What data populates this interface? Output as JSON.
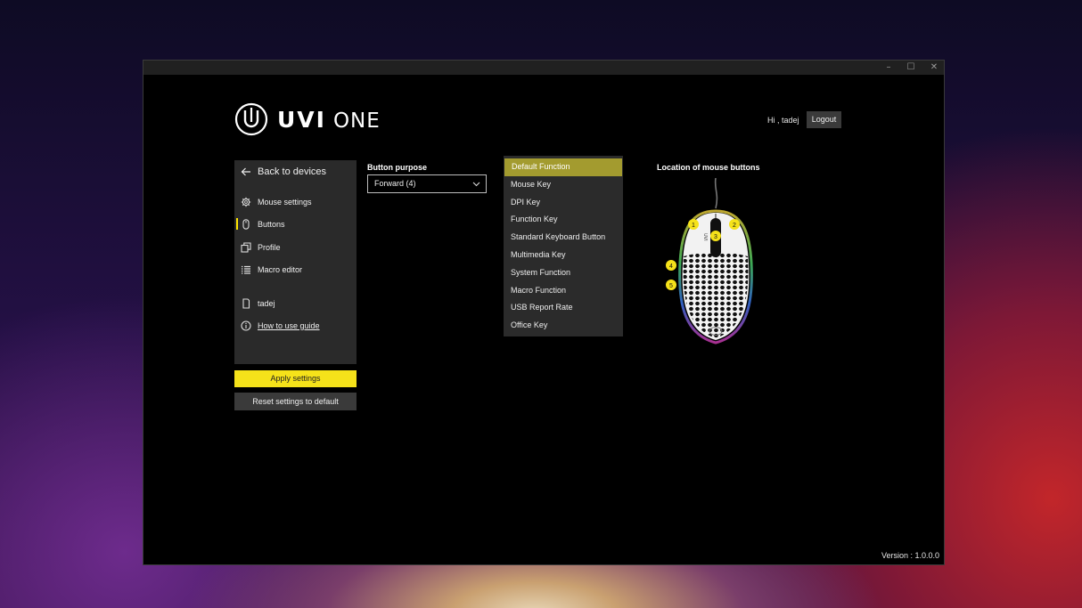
{
  "window": {
    "controls": {
      "minimize": "–",
      "maximize": "☐",
      "close": "✕"
    }
  },
  "logo": {
    "brand": "UVI",
    "suffix": "ONE"
  },
  "header": {
    "greeting": "Hi , tadej",
    "logout_label": "Logout"
  },
  "sidebar": {
    "back_label": "Back to devices",
    "items": [
      {
        "label": "Mouse settings",
        "icon": "gear-icon",
        "active": false
      },
      {
        "label": "Buttons",
        "icon": "mouse-icon",
        "active": true
      },
      {
        "label": "Profile",
        "icon": "copy-icon",
        "active": false
      },
      {
        "label": "Macro editor",
        "icon": "list-icon",
        "active": false
      }
    ],
    "user_label": "tadej",
    "guide_label": "How to use guide"
  },
  "actions": {
    "apply_label": "Apply settings",
    "reset_label": "Reset settings to default"
  },
  "button_purpose": {
    "label": "Button purpose",
    "selected": "Forward (4)",
    "options": [
      "Default Function",
      "Mouse Key",
      "DPI Key",
      "Function Key",
      "Standard Keyboard Button",
      "Multimedia Key",
      "System Function",
      "Macro Function",
      "USB Report Rate",
      "Office Key"
    ],
    "highlighted_index": 0
  },
  "mouse_diagram": {
    "label": "Location of mouse buttons",
    "markers": [
      "1",
      "2",
      "3",
      "4",
      "5"
    ]
  },
  "footer": {
    "version": "Version :  1.0.0.0"
  },
  "colors": {
    "accent": "#f5e21a",
    "highlight": "#a39b2f",
    "panel": "#2a2a2a"
  }
}
